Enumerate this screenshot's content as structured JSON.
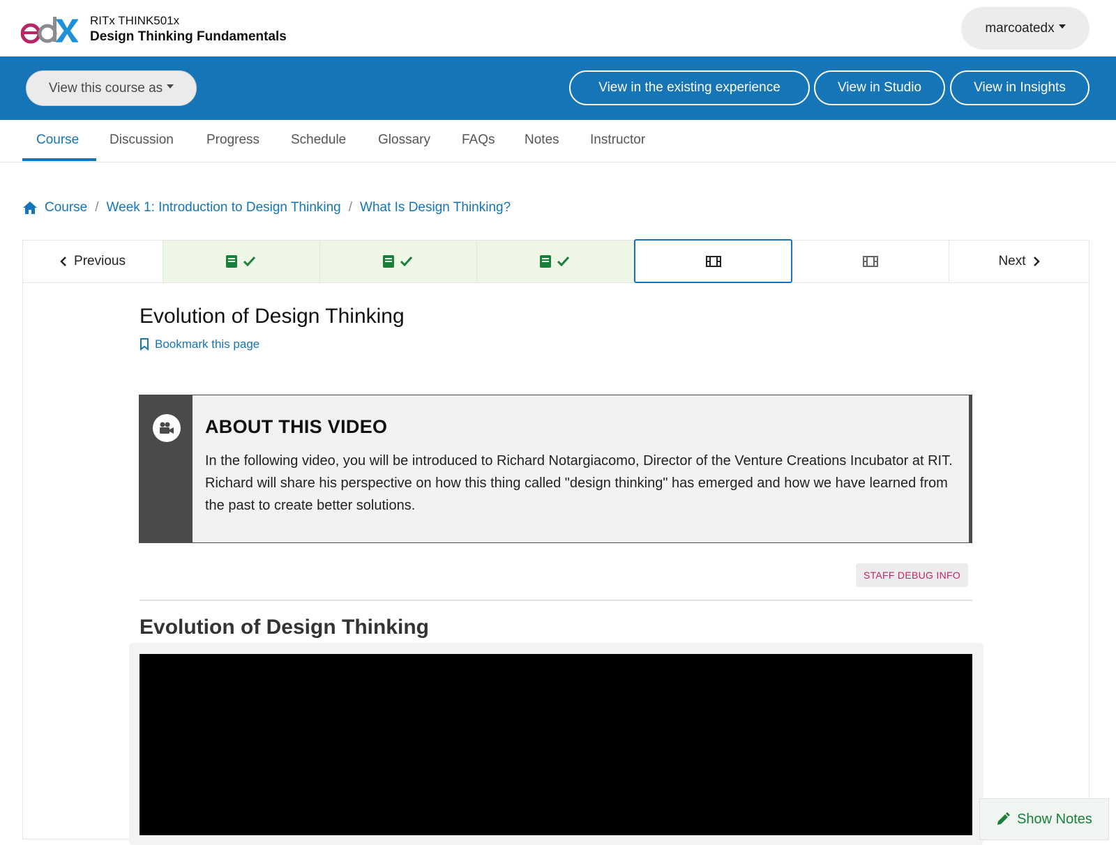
{
  "header": {
    "logo_text": "edX",
    "course_org": "RITx THINK501x",
    "course_title": "Design Thinking Fundamentals",
    "user_menu": "marcoatedx"
  },
  "staff_bar": {
    "view_as": "View this course as",
    "buttons": [
      "View in the existing experience",
      "View in Studio",
      "View in Insights"
    ]
  },
  "tabs": [
    "Course",
    "Discussion",
    "Progress",
    "Schedule",
    "Glossary",
    "FAQs",
    "Notes",
    "Instructor"
  ],
  "active_tab": "Course",
  "breadcrumb": [
    "Course",
    "Week 1: Introduction to Design Thinking",
    "What Is Design Thinking?"
  ],
  "sequence_nav": {
    "previous": "Previous",
    "next": "Next",
    "units": [
      {
        "type": "text",
        "complete": true
      },
      {
        "type": "text",
        "complete": true
      },
      {
        "type": "text",
        "complete": true
      },
      {
        "type": "video",
        "complete": false,
        "current": true
      },
      {
        "type": "video",
        "complete": false,
        "current": false
      }
    ]
  },
  "unit": {
    "title": "Evolution of Design Thinking",
    "bookmark": "Bookmark this page",
    "about_title": "ABOUT THIS VIDEO",
    "about_text": "In the following video, you will be introduced to Richard Notargiacomo, Director of the Venture Creations Incubator at RIT. Richard will share his perspective on how this thing called \"design thinking\" has emerged and how we have learned from the past to create better solutions.",
    "debug_button": "STAFF DEBUG INFO",
    "video_heading": "Evolution of Design Thinking",
    "show_notes": "Show Notes"
  },
  "colors": {
    "brand_blue": "#1575b7",
    "complete_green": "#1b7f3c",
    "complete_bg": "#eef6e6",
    "debug_pink": "#c0256a"
  }
}
